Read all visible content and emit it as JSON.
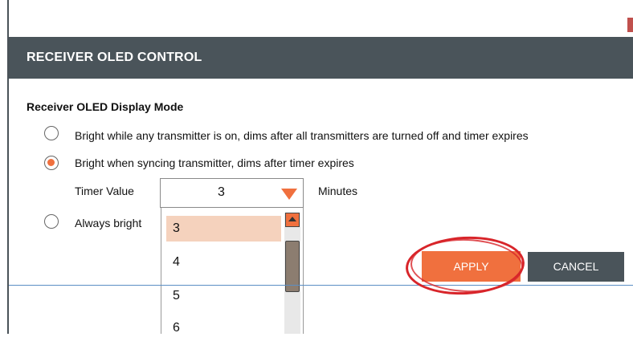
{
  "header": {
    "title": "RECEIVER OLED CONTROL"
  },
  "section": {
    "title": "Receiver OLED Display Mode"
  },
  "options": [
    {
      "label": "Bright while any transmitter is on, dims after all transmitters are turned off and timer expires",
      "checked": false
    },
    {
      "label": "Bright when syncing transmitter, dims after timer expires",
      "checked": true
    },
    {
      "label": "Always bright",
      "checked": false
    }
  ],
  "timer": {
    "label": "Timer Value",
    "value": "3",
    "unit": "Minutes",
    "options": [
      "3",
      "4",
      "5",
      "6"
    ]
  },
  "buttons": {
    "apply": "APPLY",
    "cancel": "CANCEL"
  },
  "colors": {
    "accent": "#f0703e",
    "header_bg": "#4a545a",
    "annotation": "#d8252a"
  }
}
